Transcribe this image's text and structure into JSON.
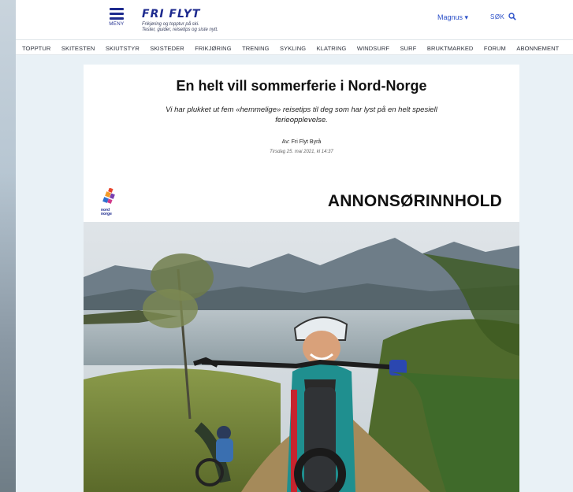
{
  "header": {
    "menu_label": "MENY",
    "logo_text": "FRI FLYT",
    "tagline_line1": "Frikjøring og topptur på ski.",
    "tagline_line2": "Tester, guider, reisetips og siste nytt.",
    "user_label": "Magnus ▾",
    "search_label": "SØK"
  },
  "nav": {
    "items": [
      "TOPPTUR",
      "SKITESTEN",
      "SKIUTSTYR",
      "SKISTEDER",
      "FRIKJØRING",
      "TRENING",
      "SYKLING",
      "KLATRING",
      "WINDSURF",
      "SURF",
      "BRUKTMARKED",
      "FORUM",
      "ABONNEMENT"
    ]
  },
  "article": {
    "title": "En helt vill sommerferie i Nord-Norge",
    "lead": "Vi har plukket ut fem «hemmelige» reisetips til deg som har lyst på en helt spesiell ferieopplevelse.",
    "byline": "Av: Fri Flyt Byrå",
    "date": "Tirsdag 25. mai 2021, kl 14:37",
    "sponsor_name": "nord norge",
    "ad_label": "ANNONSØRINNHOLD"
  },
  "colors": {
    "brand": "#1d2a8e",
    "link": "#2b50c8",
    "page_bg": "#e9f1f6"
  },
  "icons": {
    "menu": "hamburger-icon",
    "search": "magnifier-icon"
  }
}
